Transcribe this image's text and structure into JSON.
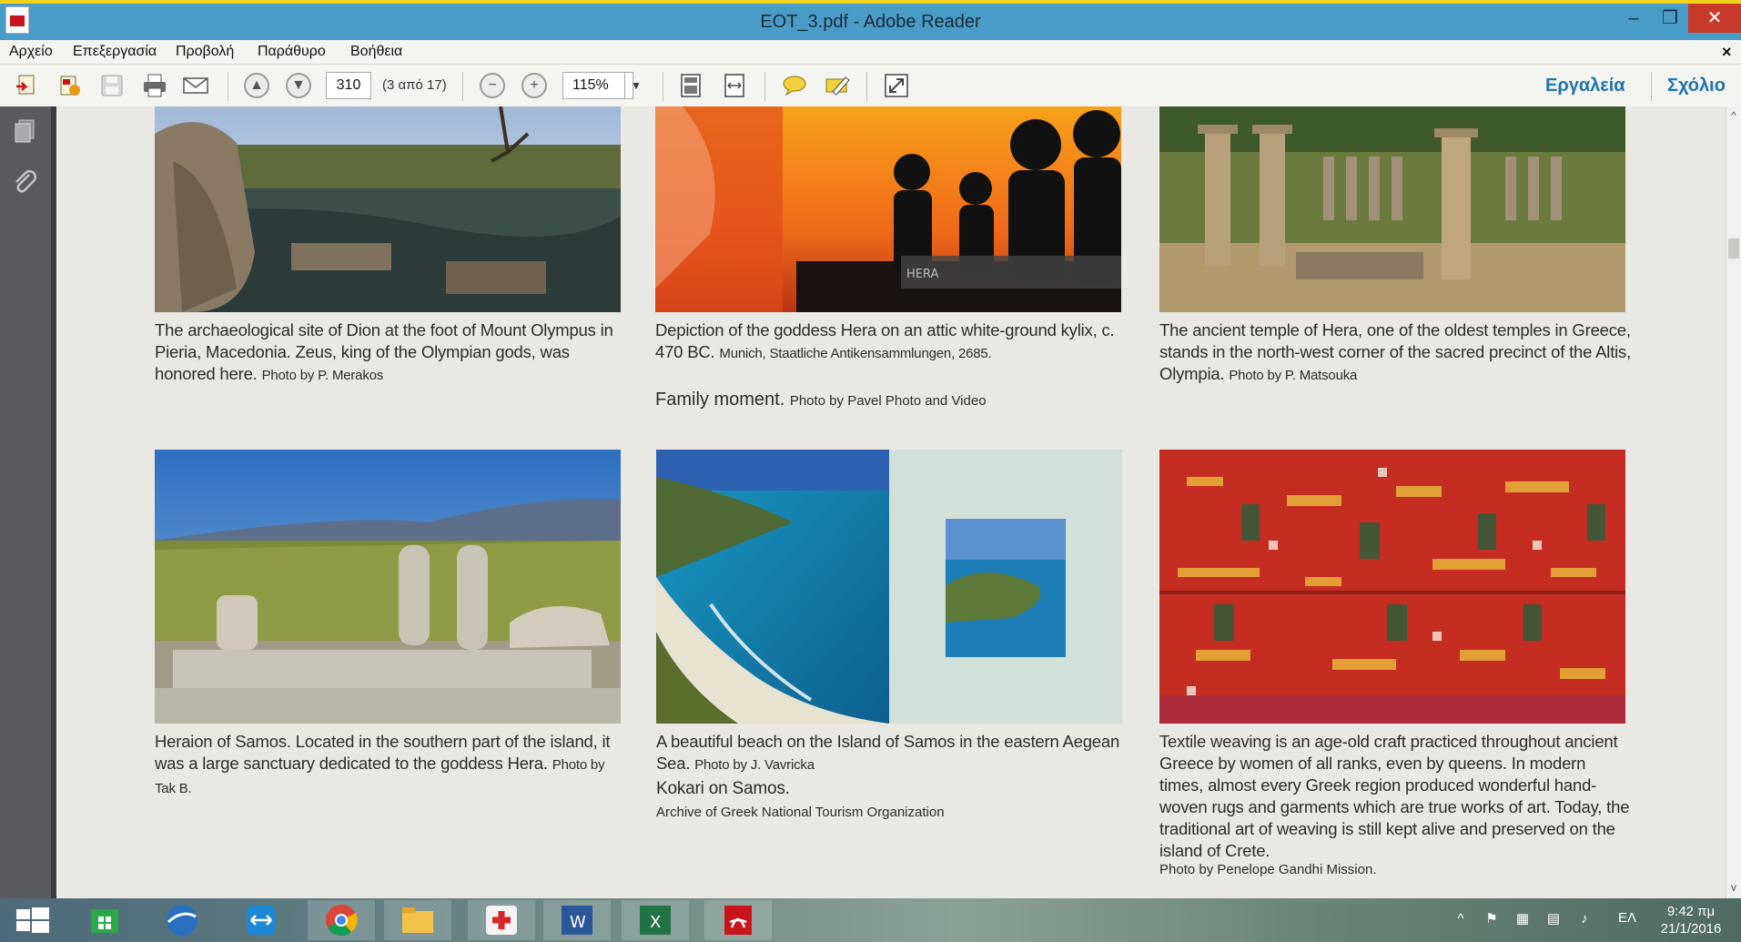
{
  "window": {
    "title": "EOT_3.pdf - Adobe Reader",
    "controls": {
      "minimize": "–",
      "maximize": "❐",
      "close": "✕"
    }
  },
  "menu": {
    "items": [
      "Αρχείο",
      "Επεξεργασία",
      "Προβολή",
      "Παράθυρο",
      "Βοήθεια"
    ],
    "close": "×"
  },
  "toolbar": {
    "page_number": "310",
    "page_count": "(3 από 17)",
    "zoom": "115%",
    "tools_label": "Εργαλεία",
    "comment_label": "Σχόλιο",
    "icons": [
      "create-pdf-icon",
      "export-pdf-icon",
      "save-icon",
      "print-icon",
      "email-icon",
      "prev-page-icon",
      "next-page-icon",
      "zoom-out-icon",
      "zoom-in-icon",
      "fit-page-icon",
      "fit-width-icon",
      "sticky-note-icon",
      "highlight-icon",
      "fullscreen-icon"
    ]
  },
  "document": {
    "captions": {
      "dion": {
        "text": "The archaeological site of Dion at the foot of Mount Olympus in Pieria, Macedonia. Zeus, king of the Olympian gods, was honored here.",
        "credit": "Photo by P. Merakos"
      },
      "hera_kylix": {
        "text": "Depiction of the goddess Hera on an attic white-ground kylix, c. 470 BC.",
        "credit": "Munich, Staatliche Antikensammlungen, 2685."
      },
      "family": {
        "text": "Family moment.",
        "credit": "Photo by Pavel Photo and Video"
      },
      "olympia": {
        "text": "The ancient temple of Hera, one of the oldest temples in Greece, stands in the north-west corner of the sacred precinct of the Altis, Olympia.",
        "credit": "Photo by P. Matsouka"
      },
      "heraion": {
        "text": "Heraion of Samos. Located in the southern part of the island, it was a large sanctuary dedicated to the goddess Hera.",
        "credit": "Photo by Tak B."
      },
      "beach": {
        "text": "A beautiful beach on the Island of Samos in the eastern Aegean Sea.",
        "credit": "Photo by J. Vavricka"
      },
      "kokari": {
        "text": "Kokari on Samos.",
        "credit": "Archive of Greek National Tourism Organization"
      },
      "textile": {
        "text": "Textile weaving is an age-old craft practiced throughout ancient Greece by women of all ranks, even by queens. In modern times, almost every Greek region produced wonderful hand-woven rugs and garments which are true works of art. Today, the traditional art of weaving is still kept alive and preserved on the island of Crete.",
        "credit": "Photo by Penelope Gandhi Mission."
      }
    },
    "hera_label": "HERA"
  },
  "taskbar": {
    "apps": [
      "start-icon",
      "store-icon",
      "google-earth-icon",
      "teamviewer-icon",
      "chrome-icon",
      "file-explorer-icon",
      "medical-app-icon",
      "word-icon",
      "excel-icon",
      "adobe-reader-icon"
    ],
    "language": "ΕΛ",
    "time": "9:42 πμ",
    "date": "21/1/2016"
  },
  "colors": {
    "titlebar": "#4a9cc8",
    "accent_text": "#1f73a8",
    "close_button": "#c7392a"
  }
}
